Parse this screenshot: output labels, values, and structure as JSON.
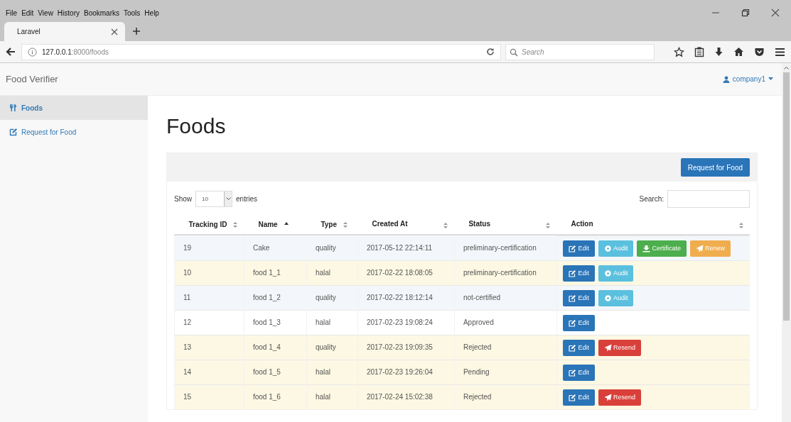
{
  "menu_bar": [
    "File",
    "Edit",
    "View",
    "History",
    "Bookmarks",
    "Tools",
    "Help"
  ],
  "tabs": [
    {
      "label": "Laravel",
      "selected": true
    }
  ],
  "address_bar": {
    "host": "127.0.0.1",
    "path": ":8000/foods"
  },
  "search_field": {
    "placeholder": "Search"
  },
  "navbar": {
    "brand": "Food Verifier",
    "user": "company1"
  },
  "sidebar": {
    "items": [
      {
        "label": "Foods",
        "selected": true
      },
      {
        "label": "Request for Food",
        "selected": false
      }
    ]
  },
  "page": {
    "heading": "Foods",
    "panel_button": "Request for Food"
  },
  "table_controls": {
    "show_label": "Show",
    "page_size": "10",
    "entries_label": "entries",
    "search_label": "Search:"
  },
  "table": {
    "columns": [
      {
        "label": "Tracking ID",
        "sorted": false
      },
      {
        "label": "Name",
        "sorted": true
      },
      {
        "label": "Type",
        "sorted": false
      },
      {
        "label": "Created At",
        "sorted": false
      },
      {
        "label": "Status",
        "sorted": false
      },
      {
        "label": "Action",
        "sorted": false
      }
    ],
    "rows": [
      {
        "color": "#f3f7fb",
        "cells": [
          "19",
          "Cake",
          "quality",
          "2017-05-12 22:14:11",
          "preliminary-certification"
        ],
        "actions": [
          {
            "kind": "edit",
            "label": "Edit"
          },
          {
            "kind": "audit",
            "label": "Audit"
          },
          {
            "kind": "certificate",
            "label": "Certificate"
          },
          {
            "kind": "renew",
            "label": "Renew"
          }
        ]
      },
      {
        "color": "#fcf8e3",
        "cells": [
          "10",
          "food 1_1",
          "halal",
          "2017-02-22 18:08:05",
          "preliminary-certification"
        ],
        "actions": [
          {
            "kind": "edit",
            "label": "Edit"
          },
          {
            "kind": "audit",
            "label": "Audit"
          }
        ]
      },
      {
        "color": "#f3f7fb",
        "cells": [
          "11",
          "food 1_2",
          "quality",
          "2017-02-22 18:12:14",
          "not-certified"
        ],
        "actions": [
          {
            "kind": "edit",
            "label": "Edit"
          },
          {
            "kind": "audit",
            "label": "Audit"
          }
        ]
      },
      {
        "color": "#ffffff",
        "cells": [
          "12",
          "food 1_3",
          "halal",
          "2017-02-23 19:08:24",
          "Approved"
        ],
        "actions": [
          {
            "kind": "edit",
            "label": "Edit"
          }
        ]
      },
      {
        "color": "#fcf8e3",
        "cells": [
          "13",
          "food 1_4",
          "quality",
          "2017-02-23 19:09:35",
          "Rejected"
        ],
        "actions": [
          {
            "kind": "edit",
            "label": "Edit"
          },
          {
            "kind": "resend",
            "label": "Resend"
          }
        ]
      },
      {
        "color": "#fcf8e3",
        "cells": [
          "14",
          "food 1_5",
          "halal",
          "2017-02-23 19:26:04",
          "Pending"
        ],
        "actions": [
          {
            "kind": "edit",
            "label": "Edit"
          }
        ]
      },
      {
        "color": "#fcf8e3",
        "cells": [
          "15",
          "food 1_6",
          "halal",
          "2017-02-24 15:02:38",
          "Rejected"
        ],
        "actions": [
          {
            "kind": "edit",
            "label": "Edit"
          },
          {
            "kind": "resend",
            "label": "Resend"
          }
        ]
      }
    ]
  }
}
